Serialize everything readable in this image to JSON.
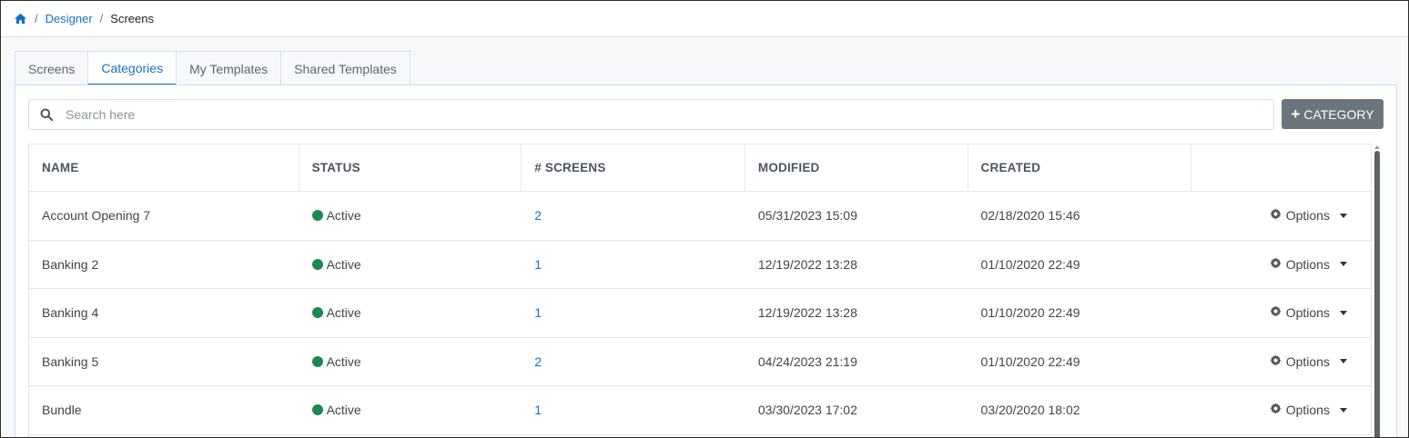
{
  "breadcrumb": {
    "home_icon": "home-icon",
    "items": [
      "Designer",
      "Screens"
    ],
    "separator": "/"
  },
  "tabs": [
    {
      "label": "Screens",
      "active": false
    },
    {
      "label": "Categories",
      "active": true
    },
    {
      "label": "My Templates",
      "active": false
    },
    {
      "label": "Shared Templates",
      "active": false
    }
  ],
  "search": {
    "placeholder": "Search here",
    "icon": "search-icon"
  },
  "add_button": {
    "label": "CATEGORY",
    "icon": "plus-icon"
  },
  "table": {
    "columns": [
      "NAME",
      "STATUS",
      "# SCREENS",
      "MODIFIED",
      "CREATED",
      ""
    ],
    "rows": [
      {
        "name": "Account Opening 7",
        "status": "Active",
        "screens": "2",
        "modified": "05/31/2023 15:09",
        "created": "02/18/2020 15:46",
        "options": "Options"
      },
      {
        "name": "Banking 2",
        "status": "Active",
        "screens": "1",
        "modified": "12/19/2022 13:28",
        "created": "01/10/2020 22:49",
        "options": "Options"
      },
      {
        "name": "Banking 4",
        "status": "Active",
        "screens": "1",
        "modified": "12/19/2022 13:28",
        "created": "01/10/2020 22:49",
        "options": "Options"
      },
      {
        "name": "Banking 5",
        "status": "Active",
        "screens": "2",
        "modified": "04/24/2023 21:19",
        "created": "01/10/2020 22:49",
        "options": "Options"
      },
      {
        "name": "Bundle",
        "status": "Active",
        "screens": "1",
        "modified": "03/30/2023 17:02",
        "created": "03/20/2020 18:02",
        "options": "Options"
      }
    ]
  },
  "colors": {
    "accent": "#1572c2",
    "status_active": "#1b8a4f",
    "button_bg": "#6c757d"
  }
}
